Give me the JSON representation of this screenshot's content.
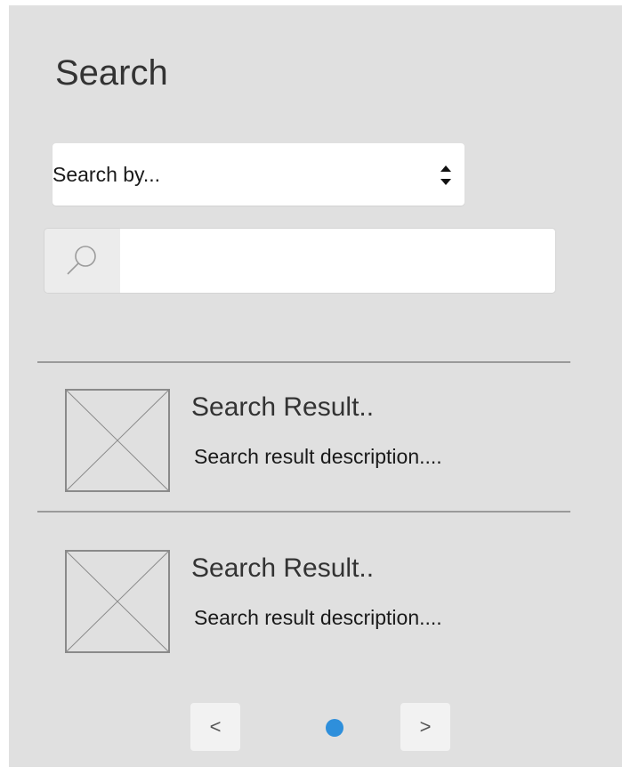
{
  "header": {
    "title": "Search"
  },
  "search_by": {
    "selected": "Search by..."
  },
  "search": {
    "value": "",
    "placeholder": ""
  },
  "results": [
    {
      "title": "Search Result..",
      "description": "Search result description...."
    },
    {
      "title": "Search Result..",
      "description": "Search result description...."
    }
  ],
  "pagination": {
    "prev_label": "<",
    "next_label": ">"
  },
  "colors": {
    "panel_background": "#e0e0e0",
    "active_dot": "#2e8fdb",
    "divider": "#9a9a9a",
    "text": "#333333"
  },
  "icons": {
    "select_arrows": "sort-icon",
    "search": "search-icon",
    "thumbnail": "image-placeholder-icon"
  }
}
